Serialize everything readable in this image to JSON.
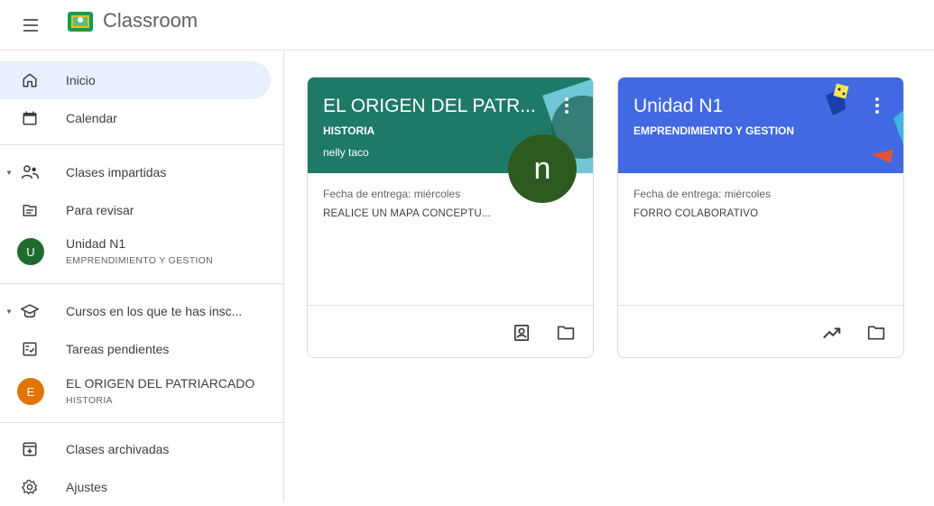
{
  "header": {
    "app_title": "Classroom",
    "menu_icon": "hamburger-menu-icon",
    "logo_icon": "classroom-logo-icon"
  },
  "sidebar": {
    "home": {
      "label": "Inicio",
      "icon": "home-icon"
    },
    "calendar": {
      "label": "Calendar",
      "icon": "calendar-icon"
    },
    "teaching": {
      "label": "Clases impartidas",
      "icon": "people-icon"
    },
    "to_review": {
      "label": "Para revisar",
      "icon": "folder-review-icon"
    },
    "taught_class": {
      "label": "Unidad N1",
      "sub": "EMPRENDIMIENTO Y GESTION",
      "avatar": "U",
      "color": "#1e6b2e"
    },
    "enrolled": {
      "label": "Cursos en los que te has insc...",
      "icon": "graduation-cap-icon"
    },
    "todo": {
      "label": "Tareas pendientes",
      "icon": "checklist-icon"
    },
    "enrolled_class": {
      "label": "EL ORIGEN DEL PATRIARCADO",
      "sub": "HISTORIA",
      "avatar": "E",
      "color": "#e37400"
    },
    "archived": {
      "label": "Clases archivadas",
      "icon": "archive-icon"
    },
    "settings": {
      "label": "Ajustes",
      "icon": "gear-icon"
    }
  },
  "cards": [
    {
      "title": "EL ORIGEN DEL PATR...",
      "section": "HISTORIA",
      "teacher": "nelly taco",
      "teacher_initial": "n",
      "due_label": "Fecha de entrega: miércoles",
      "due_task": "REALICE UN MAPA CONCEPTU...",
      "header_color": "#1e7a66",
      "footer_icons": [
        "student-work-icon",
        "folder-icon"
      ]
    },
    {
      "title": "Unidad N1",
      "section": "EMPRENDIMIENTO Y GESTION",
      "due_label": "Fecha de entrega: miércoles",
      "due_task": "FORRO COLABORATIVO",
      "header_color": "#4169e1",
      "footer_icons": [
        "trending-up-icon",
        "folder-icon"
      ]
    }
  ]
}
